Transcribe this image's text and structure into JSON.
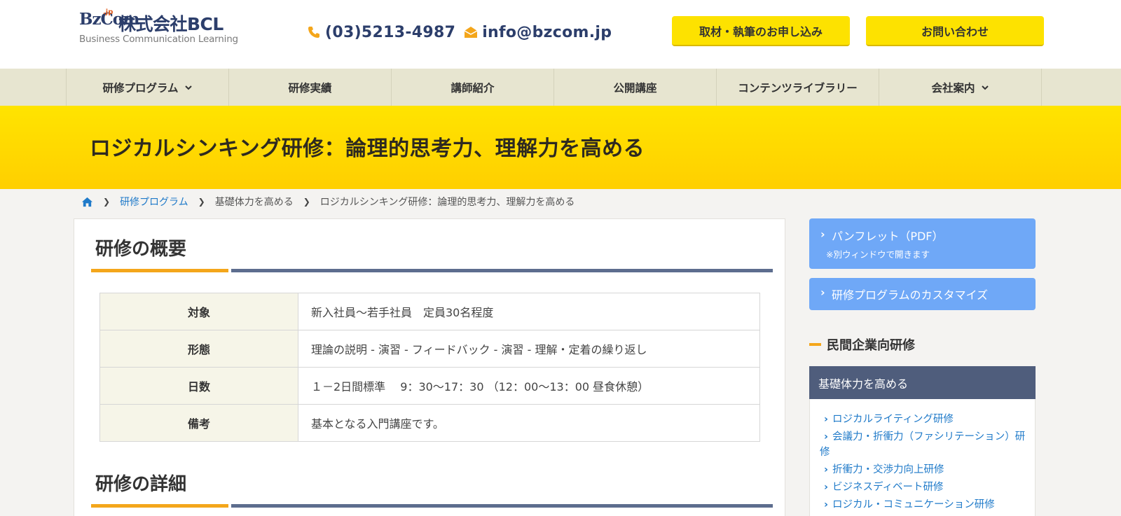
{
  "header": {
    "logo": {
      "mark": "BzCom",
      "mark_sup": ".jp",
      "company": "株式会社BCL",
      "tagline": "Business Communication Learning"
    },
    "phone": "(03)5213-4987",
    "email": "info@bzcom.jp",
    "buttons": {
      "interview": "取材・執筆のお申し込み",
      "contact": "お問い合わせ"
    }
  },
  "nav": {
    "items": [
      {
        "label": "研修プログラム",
        "dropdown": true
      },
      {
        "label": "研修実績",
        "dropdown": false
      },
      {
        "label": "講師紹介",
        "dropdown": false
      },
      {
        "label": "公開講座",
        "dropdown": false
      },
      {
        "label": "コンテンツライブラリー",
        "dropdown": false
      },
      {
        "label": "会社案内",
        "dropdown": true
      }
    ]
  },
  "page_title": "ロジカルシンキング研修：論理的思考力、理解力を高める",
  "breadcrumb": {
    "items": [
      "研修プログラム",
      "基礎体力を高める",
      "ロジカルシンキング研修：論理的思考力、理解力を高める"
    ]
  },
  "overview": {
    "title": "研修の概要",
    "rows": [
      {
        "label": "対象",
        "value": "新入社員～若手社員　定員30名程度"
      },
      {
        "label": "形態",
        "value": "理論の説明 - 演習 - フィードバック - 演習 - 理解・定着の繰り返し"
      },
      {
        "label": "日数",
        "value": "１－2日間標準　 9：30～17：30 （12：00～13：00 昼食休憩）"
      },
      {
        "label": "備考",
        "value": "基本となる入門講座です。"
      }
    ]
  },
  "details": {
    "title": "研修の詳細"
  },
  "sidebar": {
    "pamphlet": {
      "label": "パンフレット（PDF）",
      "note": "※別ウィンドウで開きます"
    },
    "customize": {
      "label": "研修プログラムのカスタマイズ"
    },
    "section_title": "民間企業向研修",
    "category": "基礎体力を高める",
    "links": [
      "ロジカルライティング研修",
      "会議力・折衝力（ファシリテーション）研修",
      "折衝力・交渉力向上研修",
      "ビジネスディベート研修",
      "ロジカル・コミュニケーション研修"
    ]
  },
  "colors": {
    "accent_yellow": "#fde200",
    "navy": "#2c3e6b",
    "link_blue": "#1f7ac9",
    "orange": "#f4a61b",
    "sidebar_button": "#6fa8f7"
  }
}
